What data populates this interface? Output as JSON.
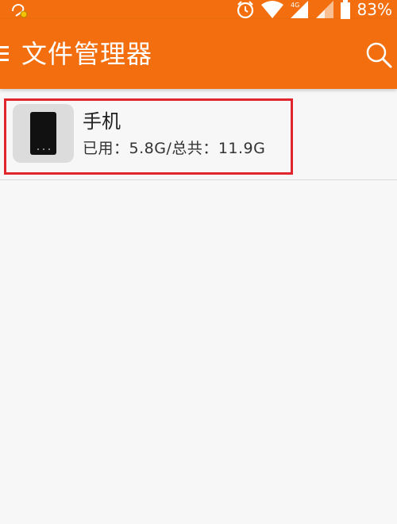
{
  "status_bar": {
    "battery_percent": "83%",
    "icons": [
      "app-notification-icon",
      "alarm-icon",
      "wifi-icon",
      "signal-4g-icon",
      "signal-icon",
      "battery-icon"
    ]
  },
  "app_bar": {
    "menu_icon": "menu-icon",
    "title": "文件管理器",
    "search_icon": "search-icon"
  },
  "storage_list": [
    {
      "icon": "phone-icon",
      "name": "手机",
      "usage": "已用：5.8G/总共：11.9G"
    }
  ],
  "colors": {
    "accent": "#f26e0e",
    "highlight": "#e0252f",
    "background": "#f7f7f7"
  }
}
